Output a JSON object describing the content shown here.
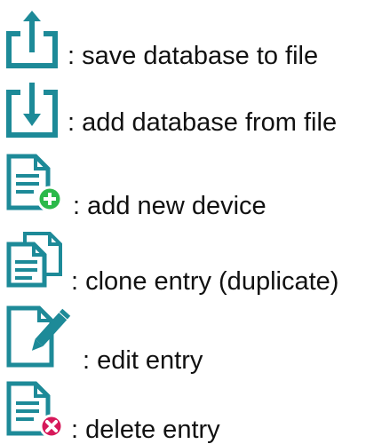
{
  "accent_color": "#1d8a98",
  "add_badge_color": "#2bb94a",
  "delete_badge_color": "#d6195a",
  "legend": [
    {
      "icon": "upload-icon",
      "text": ": save database to file"
    },
    {
      "icon": "download-icon",
      "text": ": add database from file"
    },
    {
      "icon": "add-document-icon",
      "text": ": add new device"
    },
    {
      "icon": "duplicate-documents-icon",
      "text": ": clone entry (duplicate)"
    },
    {
      "icon": "edit-document-icon",
      "text": ": edit entry"
    },
    {
      "icon": "delete-document-icon",
      "text": ": delete entry"
    }
  ]
}
